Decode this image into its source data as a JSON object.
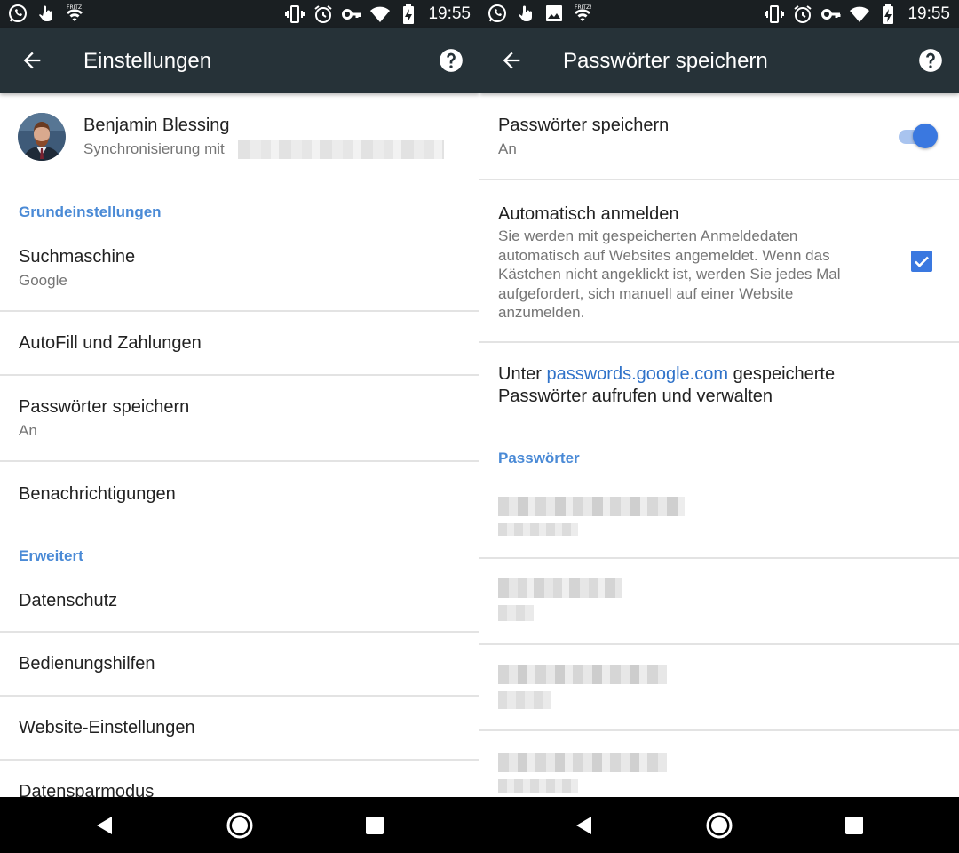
{
  "status_bar": {
    "time": "19:55",
    "left_icons": [
      "whatsapp-icon",
      "touch-icon",
      "wifi-fritz-icon"
    ],
    "left_icons_right_pane": [
      "whatsapp-icon",
      "touch-icon",
      "image-icon",
      "wifi-fritz-icon"
    ],
    "right_icons": [
      "vibrate-icon",
      "alarm-icon",
      "vpn-key-icon",
      "wifi-signal-icon",
      "battery-charging-icon"
    ]
  },
  "left": {
    "toolbar": {
      "title": "Einstellungen",
      "back_icon": "arrow-back-icon",
      "help_icon": "help-icon"
    },
    "profile": {
      "name": "Benjamin Blessing",
      "sync_label": "Synchronisierung mit"
    },
    "sections": {
      "basic": "Grundeinstellungen",
      "advanced": "Erweitert"
    },
    "items": {
      "search_engine": {
        "title": "Suchmaschine",
        "value": "Google"
      },
      "autofill": {
        "title": "AutoFill und Zahlungen"
      },
      "passwords": {
        "title": "Passwörter speichern",
        "value": "An"
      },
      "notifications": {
        "title": "Benachrichtigungen"
      },
      "privacy": {
        "title": "Datenschutz"
      },
      "accessibility": {
        "title": "Bedienungshilfen"
      },
      "site_settings": {
        "title": "Website-Einstellungen"
      },
      "data_saver": {
        "title": "Datensparmodus"
      }
    }
  },
  "right": {
    "toolbar": {
      "title": "Passwörter speichern",
      "back_icon": "arrow-back-icon",
      "help_icon": "help-icon"
    },
    "save_passwords": {
      "title": "Passwörter speichern",
      "value": "An",
      "enabled": true
    },
    "auto_signin": {
      "title": "Automatisch anmelden",
      "description": "Sie werden mit gespeicherten Anmeldedaten automatisch auf Websites angemeldet. Wenn das Kästchen nicht angeklickt ist, werden Sie jedes Mal aufgefordert, sich manuell auf einer Website anzumelden.",
      "checked": true
    },
    "manage": {
      "prefix": "Unter ",
      "link": "passwords.google.com",
      "suffix_line1": " gespeicherte",
      "line2": "Passwörter aufrufen und verwalten"
    },
    "passwords_section": "Passwörter"
  },
  "colors": {
    "toolbar": "#263238",
    "status_bar": "#1a1f22",
    "accent": "#3a78e0",
    "section_header": "#4a8ad6",
    "link": "#2f72c9"
  }
}
